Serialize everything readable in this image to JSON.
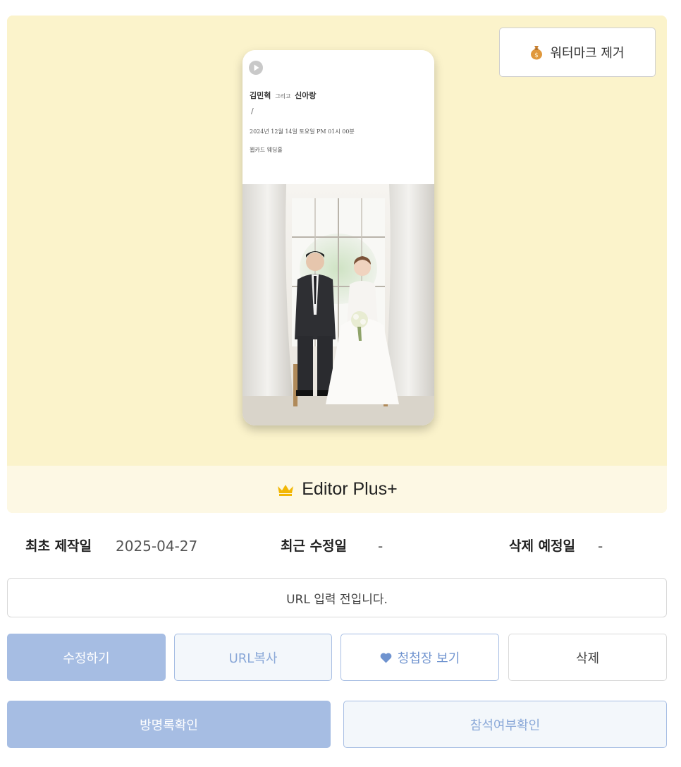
{
  "card": {
    "watermark_button": {
      "icon": "moneybag-icon",
      "label": "워터마크 제거"
    },
    "invitation_preview": {
      "names": {
        "groom": "김민혁",
        "conjunction": "그리고",
        "bride": "신아랑"
      },
      "slash": "/",
      "date_text": "2024년 12월 14일 토요일 PM 01시 00분",
      "venue": "웹카드 웨딩홀",
      "play_icon": "play-icon"
    },
    "plan": {
      "icon": "crown-icon",
      "label": "Editor Plus+"
    }
  },
  "meta": {
    "created_label": "최초 제작일",
    "created_value": "2025-04-27",
    "modified_label": "최근 수정일",
    "modified_value": "-",
    "delete_label": "삭제 예정일",
    "delete_value": "-"
  },
  "url_box": {
    "text": "URL 입력 전입니다."
  },
  "actions": {
    "edit": "수정하기",
    "copy_url": "URL복사",
    "view_invitation": "청첩장 보기",
    "delete": "삭제",
    "guestbook": "방명록확인",
    "rsvp": "참석여부확인"
  },
  "colors": {
    "card_background": "#fbf3cb",
    "plan_bar": "#fdf8e4",
    "primary_button": "#a6bde3",
    "secondary_button_bg": "#f3f7fb",
    "crown": "#f2b705"
  }
}
